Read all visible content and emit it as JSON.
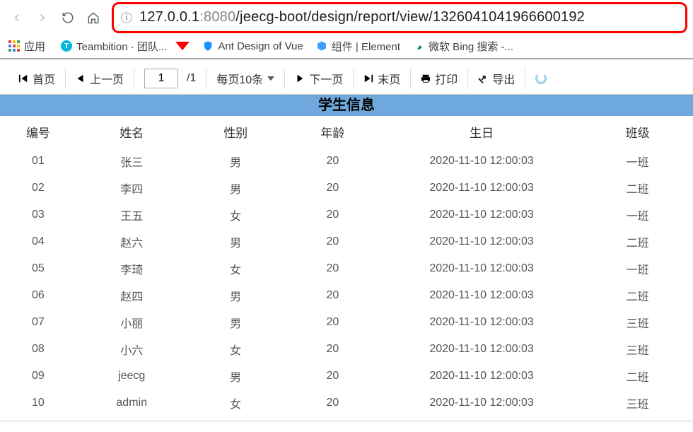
{
  "browser": {
    "url_host": "127.0.0.1",
    "url_port": ":8080",
    "url_path": "/jeecg-boot/design/report/view/1326041041966600192",
    "apps_label": "应用",
    "bookmarks": [
      {
        "label": "Teambition · 团队..."
      },
      {
        "label": "Ant Design of Vue"
      },
      {
        "label": "组件 | Element"
      },
      {
        "label": "微软 Bing 搜索 -..."
      }
    ]
  },
  "toolbar": {
    "first": "首页",
    "prev": "上一页",
    "page_current": "1",
    "page_total": "/1",
    "per_page": "每页10条",
    "next": "下一页",
    "last": "末页",
    "print": "打印",
    "export": "导出"
  },
  "table": {
    "title": "学生信息",
    "headers": [
      "编号",
      "姓名",
      "性别",
      "年龄",
      "生日",
      "班级"
    ],
    "rows": [
      [
        "01",
        "张三",
        "男",
        "20",
        "2020-11-10 12:00:03",
        "一班"
      ],
      [
        "02",
        "李四",
        "男",
        "20",
        "2020-11-10 12:00:03",
        "二班"
      ],
      [
        "03",
        "王五",
        "女",
        "20",
        "2020-11-10 12:00:03",
        "一班"
      ],
      [
        "04",
        "赵六",
        "男",
        "20",
        "2020-11-10 12:00:03",
        "二班"
      ],
      [
        "05",
        "李琦",
        "女",
        "20",
        "2020-11-10 12:00:03",
        "一班"
      ],
      [
        "06",
        "赵四",
        "男",
        "20",
        "2020-11-10 12:00:03",
        "二班"
      ],
      [
        "07",
        "小丽",
        "男",
        "20",
        "2020-11-10 12:00:03",
        "三班"
      ],
      [
        "08",
        "小六",
        "女",
        "20",
        "2020-11-10 12:00:03",
        "三班"
      ],
      [
        "09",
        "jeecg",
        "男",
        "20",
        "2020-11-10 12:00:03",
        "二班"
      ],
      [
        "10",
        "admin",
        "女",
        "20",
        "2020-11-10 12:00:03",
        "三班"
      ]
    ]
  }
}
